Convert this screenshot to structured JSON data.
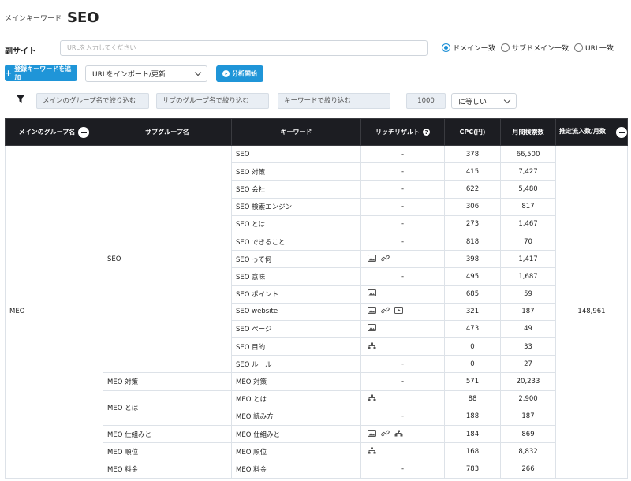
{
  "header": {
    "main_keyword_label": "メインキーワード",
    "main_keyword_value": "SEO",
    "sub_site_label": "副サイト",
    "url_placeholder": "URLを入力してください"
  },
  "match_options": [
    {
      "label": "ドメイン一致",
      "checked": true
    },
    {
      "label": "サブドメイン一致",
      "checked": false
    },
    {
      "label": "URL一致",
      "checked": false
    }
  ],
  "toolbar": {
    "register_label": "登録キーワードを追加",
    "import_select": "URLをインポート/更新",
    "analyze_label": "分析開始"
  },
  "filters": {
    "main_group_placeholder": "メインのグループ名で絞り込む",
    "sub_group_placeholder": "サブのグループ名で絞り込む",
    "keyword_placeholder": "キーワードで絞り込む",
    "volume_value": "1000",
    "condition": "に等しい"
  },
  "table": {
    "headers": {
      "main_group": "メインのグループ名",
      "sub_group": "サブグループ名",
      "keyword": "キーワード",
      "rich_result": "リッチリザルト",
      "cpc": "CPC(円)",
      "monthly_search": "月間検索数",
      "estimated_traffic": "推定流入数/月数"
    },
    "main_group_value": "MEO",
    "estimated_traffic_value": "148,961",
    "rows": [
      {
        "sub": "SEO",
        "keyword": "SEO",
        "rich": "-",
        "icons": [],
        "cpc": "378",
        "volume": "66,500"
      },
      {
        "sub": "",
        "keyword": "SEO 対策",
        "rich": "-",
        "icons": [],
        "cpc": "415",
        "volume": "7,427"
      },
      {
        "sub": "",
        "keyword": "SEO 会社",
        "rich": "-",
        "icons": [],
        "cpc": "622",
        "volume": "5,480"
      },
      {
        "sub": "",
        "keyword": "SEO 検索エンジン",
        "rich": "-",
        "icons": [],
        "cpc": "306",
        "volume": "817"
      },
      {
        "sub": "",
        "keyword": "SEO とは",
        "rich": "-",
        "icons": [],
        "cpc": "273",
        "volume": "1,467"
      },
      {
        "sub": "",
        "keyword": "SEO できること",
        "rich": "-",
        "icons": [],
        "cpc": "818",
        "volume": "70"
      },
      {
        "sub": "",
        "keyword": "SEO って何",
        "rich": "",
        "icons": [
          "image",
          "link"
        ],
        "cpc": "398",
        "volume": "1,417"
      },
      {
        "sub": "",
        "keyword": "SEO 意味",
        "rich": "-",
        "icons": [],
        "cpc": "495",
        "volume": "1,687"
      },
      {
        "sub": "",
        "keyword": "SEO ポイント",
        "rich": "",
        "icons": [
          "image"
        ],
        "cpc": "685",
        "volume": "59"
      },
      {
        "sub": "",
        "keyword": "SEO website",
        "rich": "",
        "icons": [
          "image",
          "link",
          "video"
        ],
        "cpc": "321",
        "volume": "187"
      },
      {
        "sub": "",
        "keyword": "SEO ページ",
        "rich": "",
        "icons": [
          "image"
        ],
        "cpc": "473",
        "volume": "49"
      },
      {
        "sub": "",
        "keyword": "SEO 目的",
        "rich": "",
        "icons": [
          "sitemap"
        ],
        "cpc": "0",
        "volume": "33"
      },
      {
        "sub": "",
        "keyword": "SEO ルール",
        "rich": "-",
        "icons": [],
        "cpc": "0",
        "volume": "27"
      },
      {
        "sub": "MEO 対策",
        "keyword": "MEO 対策",
        "rich": "-",
        "icons": [],
        "cpc": "571",
        "volume": "20,233"
      },
      {
        "sub": "MEO とは",
        "keyword": "MEO とは",
        "rich": "",
        "icons": [
          "sitemap"
        ],
        "cpc": "88",
        "volume": "2,900"
      },
      {
        "sub": "",
        "keyword": "MEO 読み方",
        "rich": "-",
        "icons": [],
        "cpc": "188",
        "volume": "187"
      },
      {
        "sub": "MEO 仕組みと",
        "keyword": "MEO 仕組みと",
        "rich": "",
        "icons": [
          "image",
          "link",
          "sitemap"
        ],
        "cpc": "184",
        "volume": "869"
      },
      {
        "sub": "MEO 順位",
        "keyword": "MEO 順位",
        "rich": "",
        "icons": [
          "sitemap"
        ],
        "cpc": "168",
        "volume": "8,832"
      },
      {
        "sub": "MEO 料金",
        "keyword": "MEO 料金",
        "rich": "-",
        "icons": [],
        "cpc": "783",
        "volume": "266"
      }
    ]
  }
}
